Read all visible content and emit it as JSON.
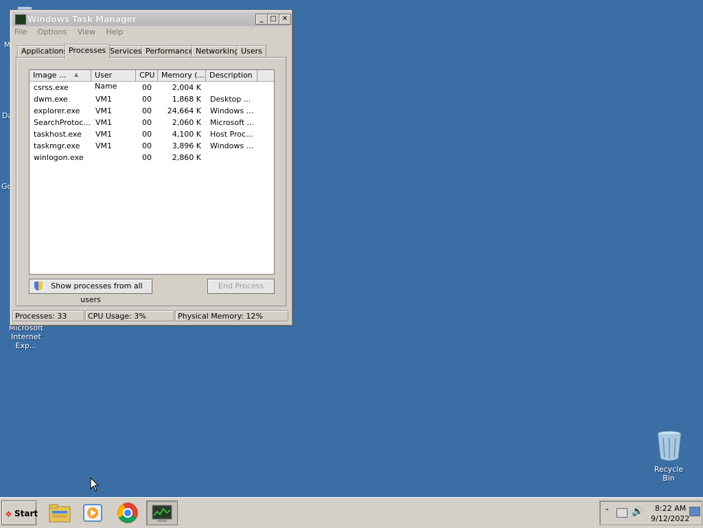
{
  "desktop": {
    "partial_labels": [
      "M",
      "Da",
      "Go"
    ],
    "ie_label_line1": "Microsoft",
    "ie_label_line2": "Internet Exp...",
    "recycle_bin_label": "Recycle Bin",
    "background_color": "#3a6ea5"
  },
  "window": {
    "title": "Windows Task Manager",
    "menu": [
      "File",
      "Options",
      "View",
      "Help"
    ],
    "tabs": [
      "Applications",
      "Processes",
      "Services",
      "Performance",
      "Networking",
      "Users"
    ],
    "active_tab": "Processes",
    "columns": [
      "Image ...",
      "User Name",
      "CPU",
      "Memory (...",
      "Description"
    ],
    "rows": [
      {
        "image": "csrss.exe",
        "user": "",
        "cpu": "00",
        "memory": "2,004 K",
        "description": ""
      },
      {
        "image": "dwm.exe",
        "user": "VM1",
        "cpu": "00",
        "memory": "1,868 K",
        "description": "Desktop ..."
      },
      {
        "image": "explorer.exe",
        "user": "VM1",
        "cpu": "00",
        "memory": "24,664 K",
        "description": "Windows ..."
      },
      {
        "image": "SearchProtoc...",
        "user": "VM1",
        "cpu": "00",
        "memory": "2,060 K",
        "description": "Microsoft ..."
      },
      {
        "image": "taskhost.exe",
        "user": "VM1",
        "cpu": "00",
        "memory": "4,100 K",
        "description": "Host Proc..."
      },
      {
        "image": "taskmgr.exe",
        "user": "VM1",
        "cpu": "00",
        "memory": "3,896 K",
        "description": "Windows ..."
      },
      {
        "image": "winlogon.exe",
        "user": "",
        "cpu": "00",
        "memory": "2,860 K",
        "description": ""
      }
    ],
    "show_all_button": "Show processes from all users",
    "end_process_button": "End Process",
    "status": {
      "processes": "Processes: 33",
      "cpu": "CPU Usage: 3%",
      "memory": "Physical Memory: 12%"
    }
  },
  "taskbar": {
    "start_label": "Start",
    "apps": [
      "file-explorer-icon",
      "media-player-icon",
      "chrome-icon",
      "task-manager-icon"
    ],
    "clock_time": "8:22 AM",
    "clock_date": "9/12/2022"
  }
}
